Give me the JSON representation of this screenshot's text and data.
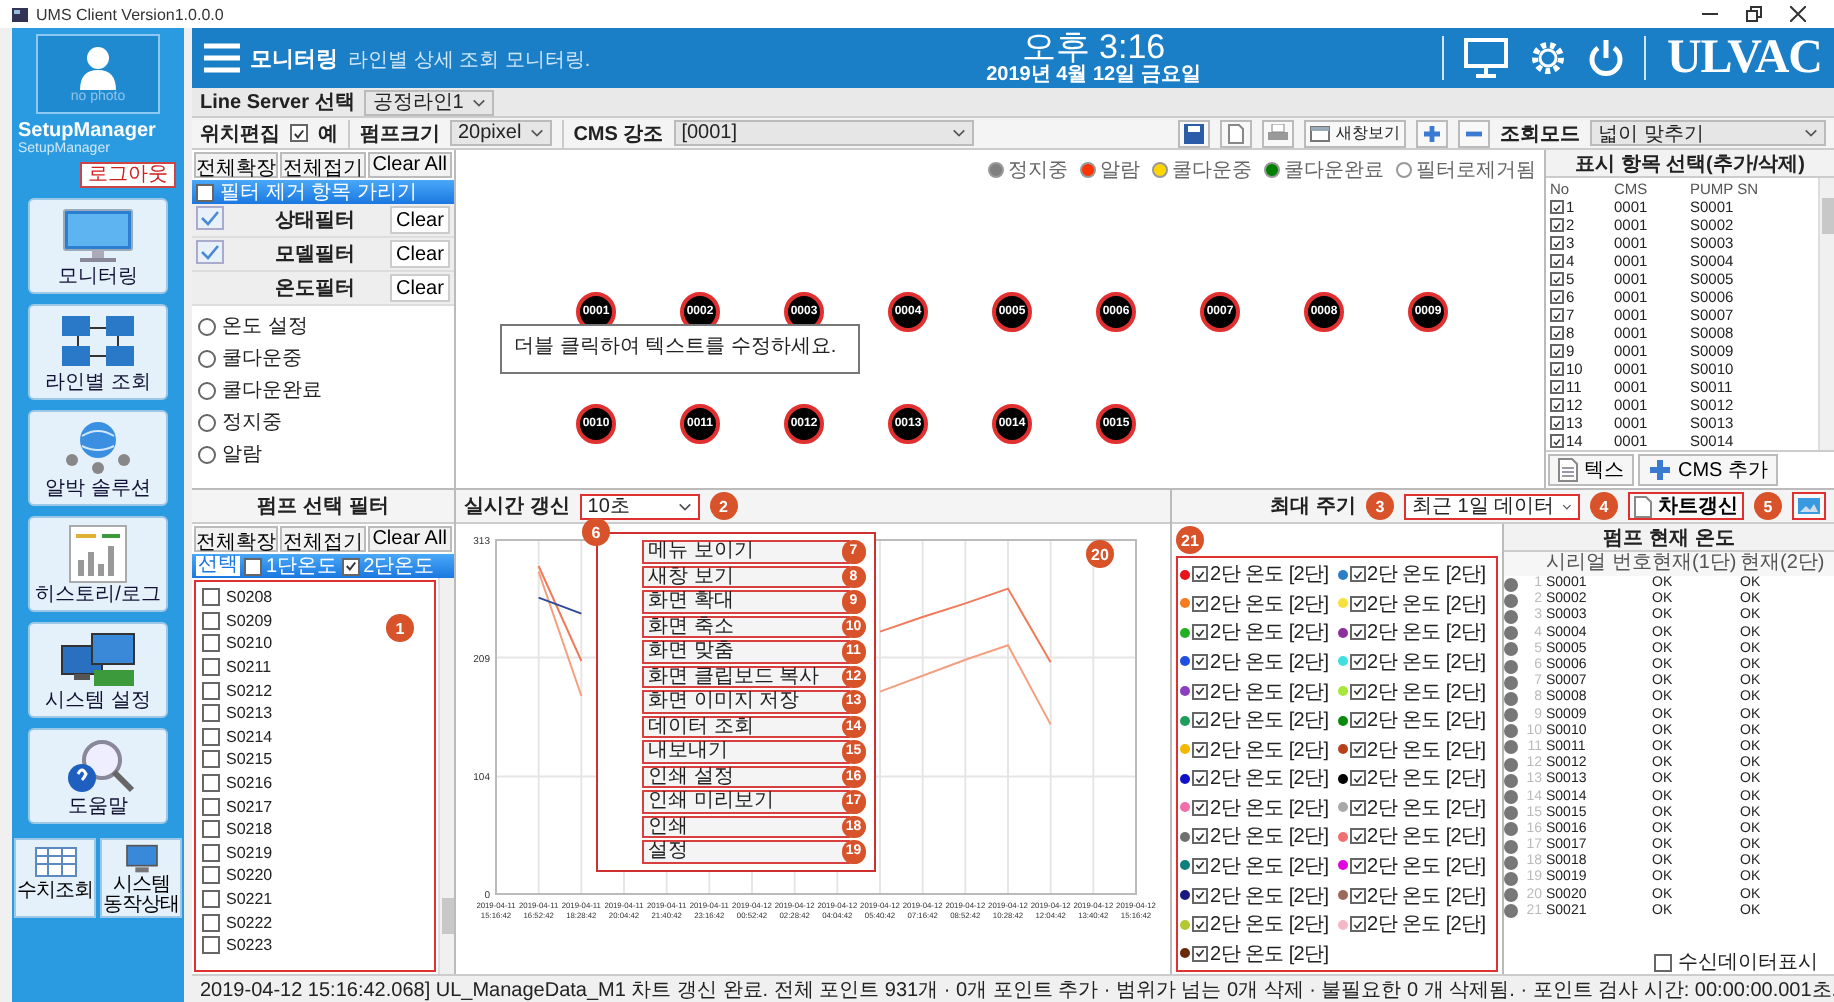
{
  "window": {
    "title": "UMS Client Version1.0.0.0"
  },
  "sidebar": {
    "photo_label": "no photo",
    "user_name": "SetupManager",
    "user_id": "SetupManager",
    "logout": "로그아웃",
    "items": [
      {
        "label": "모니터링",
        "kind": "monitor"
      },
      {
        "label": "라인별 조회",
        "kind": "network"
      },
      {
        "label": "알박 솔루션",
        "kind": "globe"
      },
      {
        "label": "히스토리/로그",
        "kind": "report"
      },
      {
        "label": "시스템 설정",
        "kind": "monitors"
      },
      {
        "label": "도움말",
        "kind": "help"
      }
    ],
    "small_items": [
      {
        "label": "수치조회",
        "kind": "table"
      },
      {
        "label": "시스템 동작상태",
        "kind": "computer"
      }
    ]
  },
  "header": {
    "title": "모니터링",
    "subtitle": "라인별 상세 조회 모니터링.",
    "time": "오후 3:16",
    "date": "2019년 4월 12일 금요일",
    "brand": "ULVAC"
  },
  "line_server": {
    "label": "Line Server 선택",
    "value": "공정라인1"
  },
  "toolbar": {
    "position_edit_label": "위치편집",
    "position_edit_checked": true,
    "position_edit_option": "예",
    "pump_size_label": "펌프크기",
    "pump_size": "20pixel",
    "cms_label": "CMS 강조",
    "cms_value": "[0001]",
    "new_window": "새창보기",
    "view_mode_label": "조회모드",
    "view_mode": "넓이 맞추기"
  },
  "filter_panel": {
    "buttons": [
      "전체확장",
      "전체접기",
      "Clear All"
    ],
    "hide_removed": {
      "label": "필터 제거 항목 가리기",
      "checked": false
    },
    "filters": [
      {
        "label": "상태필터",
        "checked": true,
        "action": "Clear"
      },
      {
        "label": "모델필터",
        "checked": true,
        "action": "Clear"
      },
      {
        "label": "온도필터",
        "checked": false,
        "action": "Clear"
      }
    ],
    "radios": [
      {
        "label": "온도 설정",
        "selected": false
      },
      {
        "label": "쿨다운중",
        "selected": false
      },
      {
        "label": "쿨다운완료",
        "selected": false
      },
      {
        "label": "정지중",
        "selected": false
      },
      {
        "label": "알람",
        "selected": false
      }
    ]
  },
  "canvas": {
    "legend": [
      {
        "label": "정지중",
        "color": "#808080"
      },
      {
        "label": "알람",
        "color": "#ff3300"
      },
      {
        "label": "쿨다운중",
        "color": "#ffd700"
      },
      {
        "label": "쿨다운완료",
        "color": "#008000"
      },
      {
        "label": "필터로제거됨",
        "color": "#ffffff"
      }
    ],
    "note": "더블 클릭하여 텍스트를 수정하세요.",
    "pumps": [
      {
        "label": "0001"
      },
      {
        "label": "0002"
      },
      {
        "label": "0003"
      },
      {
        "label": "0004"
      },
      {
        "label": "0005"
      },
      {
        "label": "0006"
      },
      {
        "label": "0007"
      },
      {
        "label": "0008"
      },
      {
        "label": "0009"
      },
      {
        "label": "0010"
      },
      {
        "label": "0011"
      },
      {
        "label": "0012"
      },
      {
        "label": "0013"
      },
      {
        "label": "0014"
      },
      {
        "label": "0015"
      }
    ]
  },
  "display_items": {
    "title": "표시 항목 선택(추가/삭제)",
    "columns": [
      "No",
      "CMS",
      "PUMP SN"
    ],
    "rows": [
      {
        "no": "1",
        "cms": "0001",
        "sn": "S0001",
        "checked": true
      },
      {
        "no": "2",
        "cms": "0001",
        "sn": "S0002",
        "checked": true
      },
      {
        "no": "3",
        "cms": "0001",
        "sn": "S0003",
        "checked": true
      },
      {
        "no": "4",
        "cms": "0001",
        "sn": "S0004",
        "checked": true
      },
      {
        "no": "5",
        "cms": "0001",
        "sn": "S0005",
        "checked": true
      },
      {
        "no": "6",
        "cms": "0001",
        "sn": "S0006",
        "checked": true
      },
      {
        "no": "7",
        "cms": "0001",
        "sn": "S0007",
        "checked": true
      },
      {
        "no": "8",
        "cms": "0001",
        "sn": "S0008",
        "checked": true
      },
      {
        "no": "9",
        "cms": "0001",
        "sn": "S0009",
        "checked": true
      },
      {
        "no": "10",
        "cms": "0001",
        "sn": "S0010",
        "checked": true
      },
      {
        "no": "11",
        "cms": "0001",
        "sn": "S0011",
        "checked": true
      },
      {
        "no": "12",
        "cms": "0001",
        "sn": "S0012",
        "checked": true
      },
      {
        "no": "13",
        "cms": "0001",
        "sn": "S0013",
        "checked": true
      },
      {
        "no": "14",
        "cms": "0001",
        "sn": "S0014",
        "checked": true
      }
    ],
    "buttons": [
      {
        "label": "텍스",
        "kind": "document"
      },
      {
        "label": "CMS 추가",
        "kind": "plus"
      }
    ]
  },
  "pump_filter": {
    "title": "펌프 선택 필터",
    "buttons": [
      "전체확장",
      "전체접기",
      "Clear All"
    ],
    "select_label": "선택",
    "stages": [
      {
        "label": "1단온도",
        "checked": false
      },
      {
        "label": "2단온도",
        "checked": true
      }
    ],
    "badge": "1",
    "items": [
      {
        "label": "S0208",
        "checked": false
      },
      {
        "label": "S0209",
        "checked": false
      },
      {
        "label": "S0210",
        "checked": false
      },
      {
        "label": "S0211",
        "checked": false
      },
      {
        "label": "S0212",
        "checked": false
      },
      {
        "label": "S0213",
        "checked": false
      },
      {
        "label": "S0214",
        "checked": false
      },
      {
        "label": "S0215",
        "checked": false
      },
      {
        "label": "S0216",
        "checked": false
      },
      {
        "label": "S0217",
        "checked": false
      },
      {
        "label": "S0218",
        "checked": false
      },
      {
        "label": "S0219",
        "checked": false
      },
      {
        "label": "S0220",
        "checked": false
      },
      {
        "label": "S0221",
        "checked": false
      },
      {
        "label": "S0222",
        "checked": false
      },
      {
        "label": "S0223",
        "checked": false
      }
    ]
  },
  "chart_panel": {
    "refresh_label": "실시간 갱신",
    "refresh_value": "10초",
    "refresh_badge": "2",
    "badge": "20",
    "chart_data": {
      "type": "line",
      "categories": [
        "2019-04-11 15:16:42",
        "2019-04-11 16:52:42",
        "2019-04-11 18:28:42",
        "2019-04-11 20:04:42",
        "2019-04-11 21:40:42",
        "2019-04-11 23:16:42",
        "2019-04-12 00:52:42",
        "2019-04-12 02:28:42",
        "2019-04-12 04:04:42",
        "2019-04-12 05:40:42",
        "2019-04-12 07:16:42",
        "2019-04-12 08:52:42",
        "2019-04-12 10:28:42",
        "2019-04-12 12:04:42",
        "2019-04-12 13:40:42",
        "2019-04-12 15:16:42"
      ],
      "ylim": [
        0,
        313
      ],
      "yticks": [
        0,
        104,
        209,
        313
      ],
      "grid": true,
      "series": [
        {
          "color": "#f07a5a",
          "values": [
            null,
            290,
            206,
            null,
            null,
            null,
            null,
            null,
            null,
            232,
            245,
            257,
            270,
            205,
            null,
            null
          ]
        },
        {
          "color": "#f4a080",
          "values": [
            null,
            285,
            175,
            null,
            null,
            null,
            null,
            null,
            null,
            179,
            193,
            207,
            220,
            150,
            null,
            null
          ]
        },
        {
          "color": "#304a9a",
          "values": [
            null,
            262,
            248,
            null,
            null,
            null,
            null,
            null,
            null,
            null,
            null,
            null,
            null,
            null,
            null,
            null
          ]
        }
      ]
    },
    "context_menu": {
      "badge": "6",
      "items": [
        {
          "label": "메뉴 보이기",
          "badge": "7"
        },
        {
          "label": "새창 보기",
          "badge": "8"
        },
        {
          "label": "화면 확대",
          "badge": "9"
        },
        {
          "label": "화면 축소",
          "badge": "10"
        },
        {
          "label": "화면 맞춤",
          "badge": "11"
        },
        {
          "label": "화면 클립보드 복사",
          "badge": "12"
        },
        {
          "label": "화면 이미지 저장",
          "badge": "13"
        },
        {
          "label": "데이터 조회",
          "badge": "14"
        },
        {
          "label": "내보내기",
          "badge": "15"
        },
        {
          "label": "인쇄 설정",
          "badge": "16"
        },
        {
          "label": "인쇄 미리보기",
          "badge": "17"
        },
        {
          "label": "인쇄",
          "badge": "18"
        },
        {
          "label": "설정",
          "badge": "19"
        }
      ]
    }
  },
  "series_legend": {
    "badge": "21",
    "items": [
      {
        "label": "2단 온도 [2단]",
        "checked": true,
        "color": "#e8141b"
      },
      {
        "label": "2단 온도 [2단]",
        "checked": true,
        "color": "#f57c1f"
      },
      {
        "label": "2단 온도 [2단]",
        "checked": true,
        "color": "#22b022"
      },
      {
        "label": "2단 온도 [2단]",
        "checked": true,
        "color": "#1f4fe0"
      },
      {
        "label": "2단 온도 [2단]",
        "checked": true,
        "color": "#8a3fc0"
      },
      {
        "label": "2단 온도 [2단]",
        "checked": true,
        "color": "#1e9e5a"
      },
      {
        "label": "2단 온도 [2단]",
        "checked": true,
        "color": "#f5b800"
      },
      {
        "label": "2단 온도 [2단]",
        "checked": true,
        "color": "#1010c8"
      },
      {
        "label": "2단 온도 [2단]",
        "checked": true,
        "color": "#f06eaa"
      },
      {
        "label": "2단 온도 [2단]",
        "checked": true,
        "color": "#707070"
      },
      {
        "label": "2단 온도 [2단]",
        "checked": true,
        "color": "#0f7f7f"
      },
      {
        "label": "2단 온도 [2단]",
        "checked": true,
        "color": "#1a1a80"
      },
      {
        "label": "2단 온도 [2단]",
        "checked": true,
        "color": "#b5c832"
      },
      {
        "label": "2단 온도 [2단]",
        "checked": true,
        "color": "#6b2a0a"
      },
      {
        "label": "2단 온도 [2단]",
        "checked": true,
        "color": "#2b7fc4"
      },
      {
        "label": "2단 온도 [2단]",
        "checked": true,
        "color": "#f7e03c"
      },
      {
        "label": "2단 온도 [2단]",
        "checked": true,
        "color": "#8e2f9e"
      },
      {
        "label": "2단 온도 [2단]",
        "checked": true,
        "color": "#40e0e0"
      },
      {
        "label": "2단 온도 [2단]",
        "checked": true,
        "color": "#a8e63c"
      },
      {
        "label": "2단 온도 [2단]",
        "checked": true,
        "color": "#0a8a0a"
      },
      {
        "label": "2단 온도 [2단]",
        "checked": true,
        "color": "#b8401a"
      },
      {
        "label": "2단 온도 [2단]",
        "checked": true,
        "color": "#000000"
      },
      {
        "label": "2단 온도 [2단]",
        "checked": true,
        "color": "#a8a8a8"
      },
      {
        "label": "2단 온도 [2단]",
        "checked": true,
        "color": "#f07070"
      },
      {
        "label": "2단 온도 [2단]",
        "checked": true,
        "color": "#e000e0"
      },
      {
        "label": "2단 온도 [2단]",
        "checked": true,
        "color": "#9b6a5a"
      },
      {
        "label": "2단 온도 [2단]",
        "checked": true,
        "color": "#f5b8c8"
      }
    ]
  },
  "current_temp": {
    "period_label": "최대 주기",
    "period_value": "최근 1일 데이터",
    "period_badge": "3",
    "refresh_button": "차트갱신",
    "refresh_badge": "4",
    "icon_badge": "5",
    "title": "펌프 현재 온도",
    "columns": [
      "시리얼 번호",
      "현재(1단)",
      "현재(2단)"
    ],
    "rows": [
      {
        "no": "1",
        "serial": "S0001",
        "stage1": "OK",
        "stage2": "OK"
      },
      {
        "no": "2",
        "serial": "S0002",
        "stage1": "OK",
        "stage2": "OK"
      },
      {
        "no": "3",
        "serial": "S0003",
        "stage1": "OK",
        "stage2": "OK"
      },
      {
        "no": "4",
        "serial": "S0004",
        "stage1": "OK",
        "stage2": "OK"
      },
      {
        "no": "5",
        "serial": "S0005",
        "stage1": "OK",
        "stage2": "OK"
      },
      {
        "no": "6",
        "serial": "S0006",
        "stage1": "OK",
        "stage2": "OK"
      },
      {
        "no": "7",
        "serial": "S0007",
        "stage1": "OK",
        "stage2": "OK"
      },
      {
        "no": "8",
        "serial": "S0008",
        "stage1": "OK",
        "stage2": "OK"
      },
      {
        "no": "9",
        "serial": "S0009",
        "stage1": "OK",
        "stage2": "OK"
      },
      {
        "no": "10",
        "serial": "S0010",
        "stage1": "OK",
        "stage2": "OK"
      },
      {
        "no": "11",
        "serial": "S0011",
        "stage1": "OK",
        "stage2": "OK"
      },
      {
        "no": "12",
        "serial": "S0012",
        "stage1": "OK",
        "stage2": "OK"
      },
      {
        "no": "13",
        "serial": "S0013",
        "stage1": "OK",
        "stage2": "OK"
      },
      {
        "no": "14",
        "serial": "S0014",
        "stage1": "OK",
        "stage2": "OK"
      },
      {
        "no": "15",
        "serial": "S0015",
        "stage1": "OK",
        "stage2": "OK"
      },
      {
        "no": "16",
        "serial": "S0016",
        "stage1": "OK",
        "stage2": "OK"
      },
      {
        "no": "17",
        "serial": "S0017",
        "stage1": "OK",
        "stage2": "OK"
      },
      {
        "no": "18",
        "serial": "S0018",
        "stage1": "OK",
        "stage2": "OK"
      },
      {
        "no": "19",
        "serial": "S0019",
        "stage1": "OK",
        "stage2": "OK"
      },
      {
        "no": "20",
        "serial": "S0020",
        "stage1": "OK",
        "stage2": "OK"
      },
      {
        "no": "21",
        "serial": "S0021",
        "stage1": "OK",
        "stage2": "OK"
      }
    ],
    "show_received": {
      "label": "수신데이터표시",
      "checked": false
    }
  },
  "status_bar": "2019-04-12 15:16:42.068] UL_ManageData_M1 차트 갱신 완료. 전체 포인트 931개 · 0개 포인트 추가 · 범위가 넘는 0개 삭제 · 불필요한 0 개 삭제됨. · 포인트 검사 시간: 00:00:00.001초."
}
